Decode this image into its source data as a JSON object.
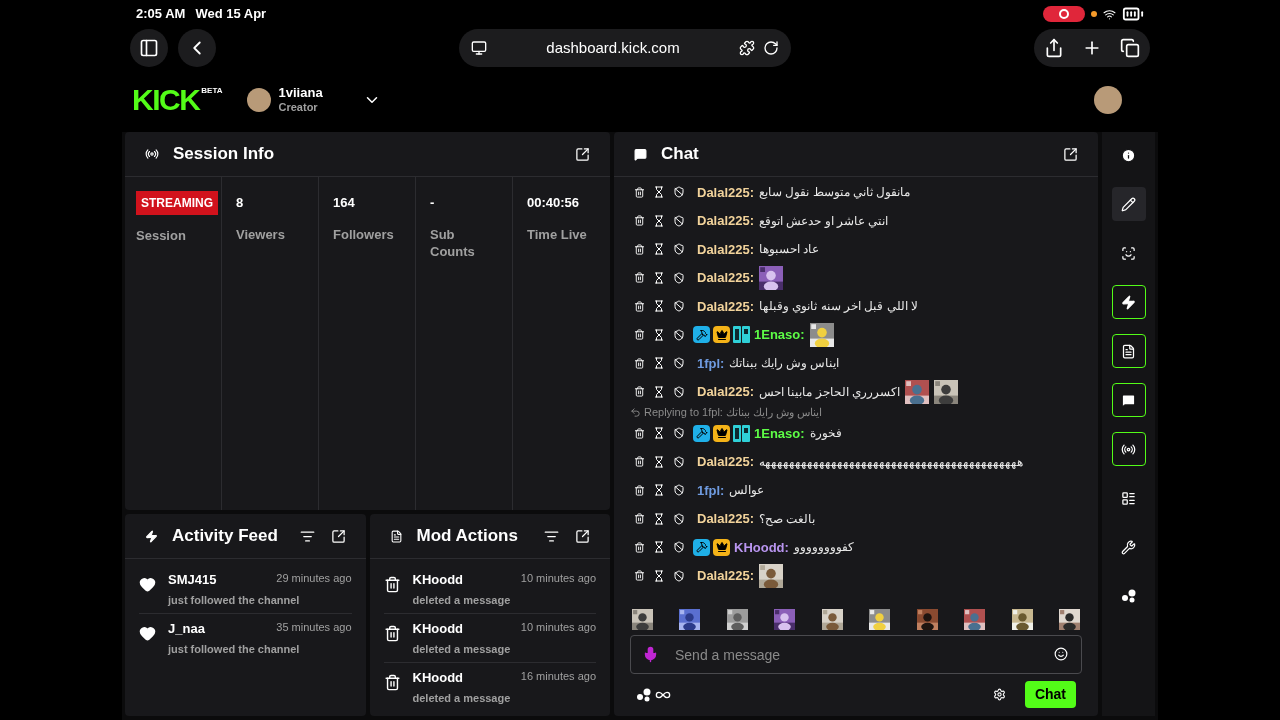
{
  "status_bar": {
    "time": "2:05 AM",
    "date": "Wed 15 Apr",
    "recording": true
  },
  "browser": {
    "url": "dashboard.kick.com"
  },
  "header": {
    "logo": "KICK",
    "logo_badge": "BETA",
    "channel": "1viiana",
    "role": "Creator"
  },
  "session_info": {
    "title": "Session Info",
    "status": "STREAMING",
    "status_label": "Session",
    "stats": [
      {
        "value": "8",
        "label": "Viewers"
      },
      {
        "value": "164",
        "label": "Followers"
      },
      {
        "value": "-",
        "label": "Sub Counts"
      },
      {
        "value": "00:40:56",
        "label": "Time Live"
      }
    ]
  },
  "activity_feed": {
    "title": "Activity Feed",
    "items": [
      {
        "user": "SMJ415",
        "time": "29 minutes ago",
        "action": "just followed the channel"
      },
      {
        "user": "J_naa",
        "time": "35 minutes ago",
        "action": "just followed the channel"
      }
    ]
  },
  "mod_actions": {
    "title": "Mod Actions",
    "items": [
      {
        "user": "KHoodd",
        "time": "10 minutes ago",
        "action": "deleted a message"
      },
      {
        "user": "KHoodd",
        "time": "10 minutes ago",
        "action": "deleted a message"
      },
      {
        "user": "KHoodd",
        "time": "16 minutes ago",
        "action": "deleted a message"
      }
    ]
  },
  "chat": {
    "title": "Chat",
    "messages": [
      {
        "kind": "message",
        "user": "Dalal225:",
        "color": "#f2d39b",
        "text": "مانقول ثاني متوسط نقول سابع"
      },
      {
        "kind": "message",
        "user": "Dalal225:",
        "color": "#f2d39b",
        "text": "انتي عاشر او حدعش اتوقع"
      },
      {
        "kind": "message",
        "user": "Dalal225:",
        "color": "#f2d39b",
        "text": "عاد احسبوها"
      },
      {
        "kind": "message",
        "user": "Dalal225:",
        "color": "#f2d39b",
        "emotes": [
          {
            "kind": "picture"
          }
        ]
      },
      {
        "kind": "message",
        "user": "Dalal225:",
        "color": "#f2d39b",
        "text": "لا اللي قبل اخر سنه ثانوي وقبلها"
      },
      {
        "kind": "message",
        "user": "1Enaso:",
        "color": "#5dfc46",
        "badges": [
          {
            "kind": "moderator"
          },
          {
            "kind": "vip"
          },
          {
            "kind": "og"
          }
        ],
        "emotes": [
          {
            "kind": "picture"
          }
        ]
      },
      {
        "kind": "message",
        "user": "1fpl:",
        "color": "#6f9be0",
        "text": "ايناس وش رايك ببناتك"
      },
      {
        "kind": "message",
        "user": "Dalal225:",
        "color": "#f2d39b",
        "text": "اكسررري الحاجز مابينا احس",
        "emotes": [
          {
            "kind": "picture"
          },
          {
            "kind": "picture"
          }
        ]
      },
      {
        "kind": "reply",
        "text": "Replying to 1fpl: ايناس وش رايك ببناتك"
      },
      {
        "kind": "message",
        "user": "1Enaso:",
        "color": "#5dfc46",
        "badges": [
          {
            "kind": "moderator"
          },
          {
            "kind": "vip"
          },
          {
            "kind": "og"
          }
        ],
        "text": "فخورة"
      },
      {
        "kind": "message",
        "user": "Dalal225:",
        "color": "#f2d39b",
        "text": "هههههههههههههههههههههههههههههههههههههههههههه"
      },
      {
        "kind": "message",
        "user": "1fpl:",
        "color": "#6f9be0",
        "text": "عوالس"
      },
      {
        "kind": "message",
        "user": "Dalal225:",
        "color": "#f2d39b",
        "text": "بالغت صح؟"
      },
      {
        "kind": "message",
        "user": "KHoodd:",
        "color": "#b995f0",
        "badges": [
          {
            "kind": "moderator"
          },
          {
            "kind": "vip"
          }
        ],
        "text": "كفوووووووو"
      },
      {
        "kind": "message",
        "user": "Dalal225:",
        "color": "#f2d39b",
        "emotes": [
          {
            "kind": "picture"
          }
        ]
      }
    ],
    "recent_emotes": [
      {
        "kind": "picture"
      },
      {
        "kind": "picture"
      },
      {
        "kind": "picture"
      },
      {
        "kind": "picture"
      },
      {
        "kind": "picture"
      },
      {
        "kind": "picture"
      },
      {
        "kind": "picture"
      },
      {
        "kind": "picture"
      },
      {
        "kind": "picture"
      },
      {
        "kind": "picture"
      }
    ],
    "input": {
      "placeholder": "Send a message"
    },
    "send_button": "Chat"
  },
  "sidebar": [
    {
      "selected": false,
      "enabled": false
    },
    {
      "selected": true,
      "enabled": false
    },
    {
      "selected": false,
      "enabled": false
    },
    {
      "selected": false,
      "enabled": true
    },
    {
      "selected": false,
      "enabled": true
    },
    {
      "selected": false,
      "enabled": true
    },
    {
      "selected": false,
      "enabled": true
    },
    {
      "selected": false,
      "enabled": false
    },
    {
      "selected": false,
      "enabled": false
    },
    {
      "selected": false,
      "enabled": false
    }
  ]
}
